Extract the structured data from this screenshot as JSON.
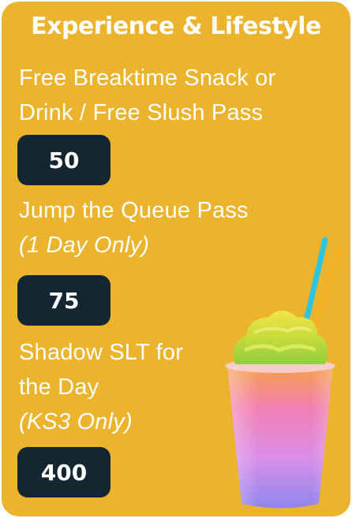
{
  "title": "Experience & Lifestyle",
  "items": [
    {
      "name": "Free Breaktime Snack or Drink / Free Slush Pass",
      "note": "",
      "price": "50"
    },
    {
      "name": "Jump the Queue Pass",
      "note": "(1 Day Only)",
      "price": "75"
    },
    {
      "name": "Shadow SLT for the Day",
      "note": "(KS3 Only)",
      "price": "400"
    }
  ],
  "colors": {
    "background": "#ecb32d",
    "badge": "#142631",
    "text": "#ffffff"
  },
  "image": {
    "icon": "slushie-drink-icon"
  }
}
